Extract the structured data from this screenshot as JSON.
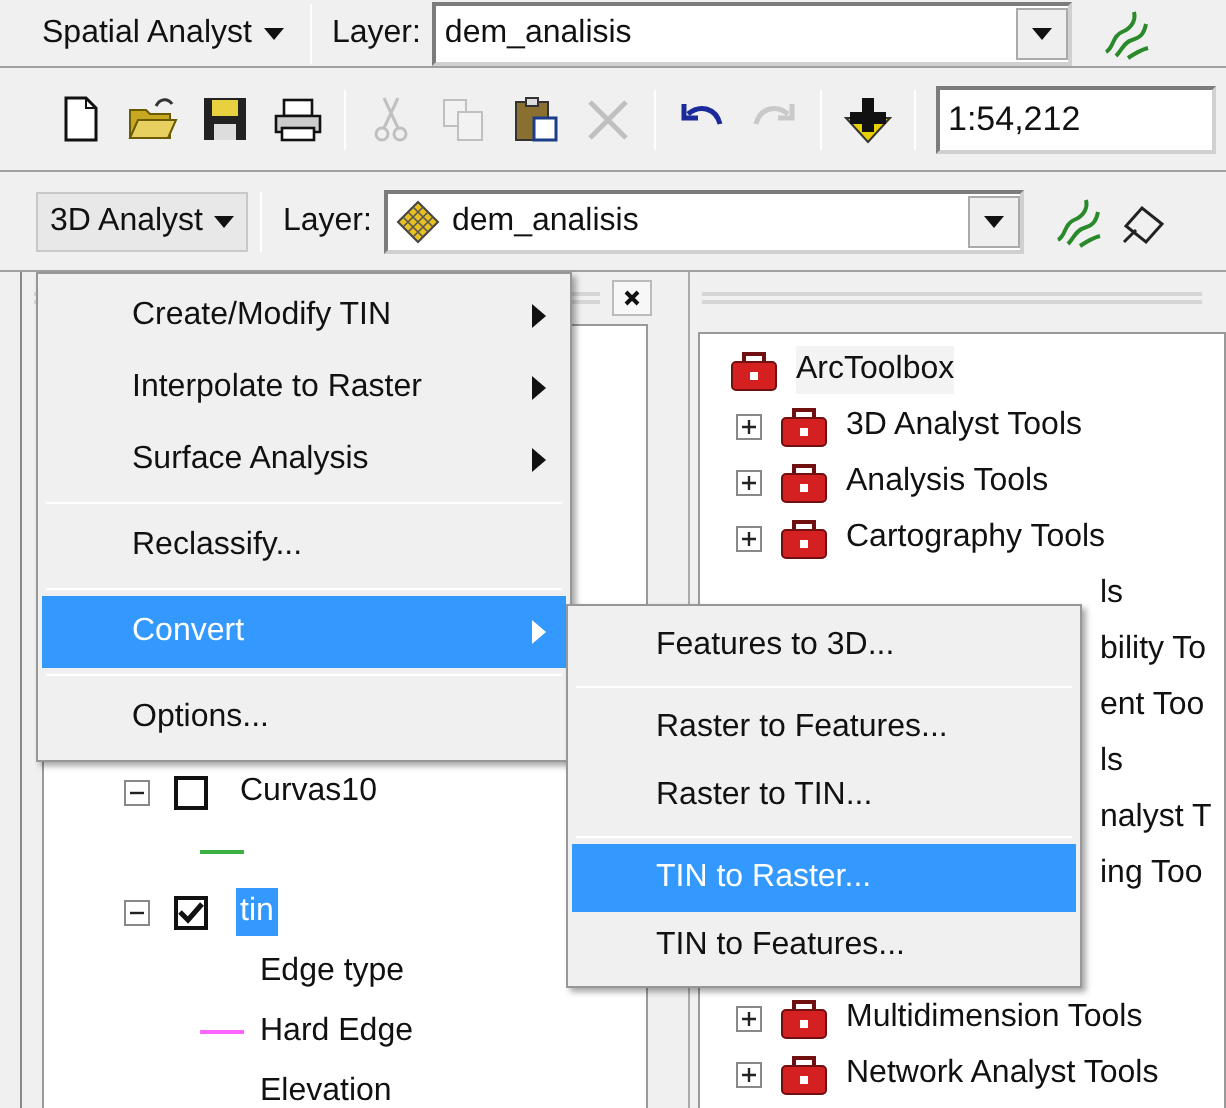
{
  "spatial_toolbar": {
    "menu": "Spatial Analyst",
    "layer_label": "Layer:",
    "layer": "dem_analisis"
  },
  "standard_toolbar": {
    "buttons": [
      {
        "kind": "button",
        "disabled": false
      },
      {
        "kind": "button",
        "disabled": false
      },
      {
        "kind": "button",
        "disabled": false
      },
      {
        "kind": "button",
        "disabled": false
      },
      {
        "kind": "separator"
      },
      {
        "kind": "button",
        "disabled": true
      },
      {
        "kind": "button",
        "disabled": true
      },
      {
        "kind": "button",
        "disabled": false
      },
      {
        "kind": "button",
        "disabled": true
      },
      {
        "kind": "separator"
      },
      {
        "kind": "button",
        "disabled": false
      },
      {
        "kind": "button",
        "disabled": true
      },
      {
        "kind": "separator"
      },
      {
        "kind": "button",
        "disabled": false
      },
      {
        "kind": "separator"
      }
    ],
    "scale": "1:54,212"
  },
  "analyst_toolbar": {
    "menu": "3D Analyst",
    "menu_open": true,
    "layer_label": "Layer:",
    "layer": "dem_analisis"
  },
  "menu": {
    "items": [
      {
        "kind": "item",
        "label": "Create/Modify TIN",
        "submenu": true,
        "selected": false
      },
      {
        "kind": "item",
        "label": "Interpolate to Raster",
        "submenu": true,
        "selected": false
      },
      {
        "kind": "item",
        "label": "Surface Analysis",
        "submenu": true,
        "selected": false
      },
      {
        "kind": "separator"
      },
      {
        "kind": "item",
        "label": "Reclassify...",
        "submenu": false,
        "selected": false
      },
      {
        "kind": "separator"
      },
      {
        "kind": "item",
        "label": "Convert",
        "submenu": true,
        "selected": true
      },
      {
        "kind": "separator"
      },
      {
        "kind": "item",
        "label": "Options...",
        "submenu": false,
        "selected": false
      }
    ]
  },
  "submenu": {
    "items": [
      {
        "kind": "item",
        "label": "Features to 3D...",
        "submenu": false,
        "selected": false
      },
      {
        "kind": "separator"
      },
      {
        "kind": "item",
        "label": "Raster to Features...",
        "submenu": false,
        "selected": false
      },
      {
        "kind": "item",
        "label": "Raster to TIN...",
        "submenu": false,
        "selected": false
      },
      {
        "kind": "separator"
      },
      {
        "kind": "item",
        "label": "TIN to Raster...",
        "submenu": false,
        "selected": true
      },
      {
        "kind": "item",
        "label": "TIN to Features...",
        "submenu": false,
        "selected": false
      }
    ]
  },
  "table_of_contents": {
    "items": [
      {
        "kind": "layer",
        "label": "Curvas10",
        "checked": false,
        "expanded": true,
        "selected": false
      },
      {
        "kind": "symbol",
        "color": "#3cb043"
      },
      {
        "kind": "layer",
        "label": "tin",
        "checked": true,
        "expanded": true,
        "selected": true
      },
      {
        "kind": "heading",
        "label": "Edge type"
      },
      {
        "kind": "symbol",
        "label": "Hard Edge",
        "color": "#ff66ff"
      },
      {
        "kind": "heading",
        "label": "Elevation"
      }
    ]
  },
  "toolbox": {
    "title": "ArcToolbox",
    "items": [
      {
        "kind": "toolset",
        "label": "3D Analyst Tools",
        "expanded": false
      },
      {
        "kind": "toolset",
        "label": "Analysis Tools",
        "expanded": false
      },
      {
        "kind": "toolset",
        "label": "Cartography Tools",
        "expanded": false
      },
      {
        "kind": "partial",
        "label": "ls"
      },
      {
        "kind": "partial",
        "label": "bility To"
      },
      {
        "kind": "partial",
        "label": "ent Too"
      },
      {
        "kind": "partial",
        "label": "ls"
      },
      {
        "kind": "partial",
        "label": "nalyst T"
      },
      {
        "kind": "partial",
        "label": "ing Too"
      },
      {
        "kind": "hidden"
      },
      {
        "kind": "toolset",
        "label": "Multidimension Tools",
        "expanded": false
      },
      {
        "kind": "toolset",
        "label": "Network Analyst Tools",
        "expanded": false
      }
    ]
  }
}
